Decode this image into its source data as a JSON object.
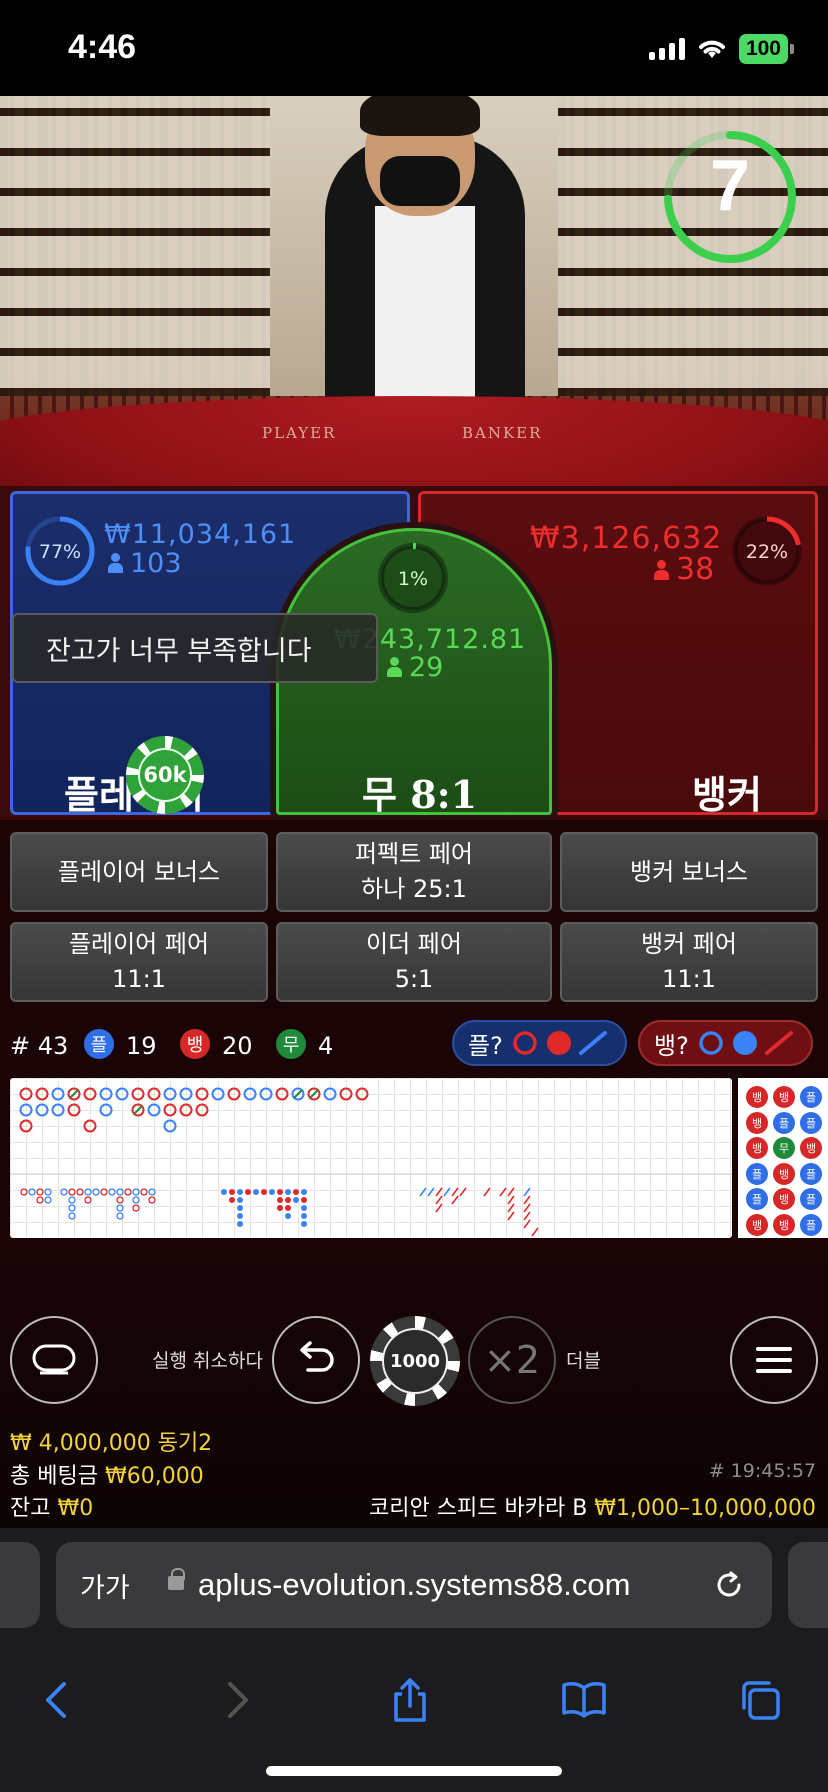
{
  "status_bar": {
    "time": "4:46",
    "battery": "100"
  },
  "video": {
    "felt_player": "PLAYER",
    "felt_banker": "BANKER",
    "countdown": "7",
    "countdown_color": "#3ccf4e"
  },
  "player": {
    "percent": "77%",
    "amount": "₩11,034,161",
    "count": "103",
    "title": "플레이어",
    "color": "#3b82f6"
  },
  "tie": {
    "percent": "1%",
    "amount": "₩243,712.81",
    "count": "29",
    "title": "무 8:1",
    "color": "#4ade54"
  },
  "banker": {
    "percent": "22%",
    "amount": "₩3,126,632",
    "count": "38",
    "title": "뱅커",
    "color": "#ef2d2d"
  },
  "chip_on_player": "60k",
  "toast": "잔고가 너무 부족합니다",
  "side_bets": {
    "player_bonus": "플레이어 보너스",
    "perfect_pair_1": "퍼펙트 페어",
    "perfect_pair_2": "하나 25:1",
    "banker_bonus": "뱅커 보너스",
    "player_pair_1": "플레이어 페어",
    "player_pair_2": "11:1",
    "either_pair_1": "이더 페어",
    "either_pair_2": "5:1",
    "banker_pair_1": "뱅커 페어",
    "banker_pair_2": "11:1"
  },
  "stats": {
    "round": "# 43",
    "player_letter": "플",
    "player_count": "19",
    "banker_letter": "뱅",
    "banker_count": "20",
    "tie_letter": "무",
    "tie_count": "4",
    "ask_player": "플?",
    "ask_banker": "뱅?"
  },
  "side_road": [
    [
      "뱅",
      "뱅",
      "플"
    ],
    [
      "뱅",
      "플",
      "플"
    ],
    [
      "뱅",
      "무",
      "뱅"
    ],
    [
      "플",
      "뱅",
      "플"
    ],
    [
      "플",
      "뱅",
      "플"
    ],
    [
      "뱅",
      "뱅",
      "플"
    ]
  ],
  "controls": {
    "undo_label": "실행 취소하다",
    "chip_value": "1000",
    "double_symbol": "×2",
    "double_label": "더블"
  },
  "info": {
    "sync": "₩ 4,000,000 동기2",
    "total_bet_label": "총 베팅금",
    "total_bet_value": "₩60,000",
    "balance_label": "잔고",
    "balance_value": "₩0",
    "timestamp": "# 19:45:57",
    "table_name": "코리안 스피드 바카라 B",
    "table_limits": "₩1,000–10,000,000"
  },
  "browser": {
    "aa_label": "가가",
    "url": "aplus-evolution.systems88.com"
  }
}
